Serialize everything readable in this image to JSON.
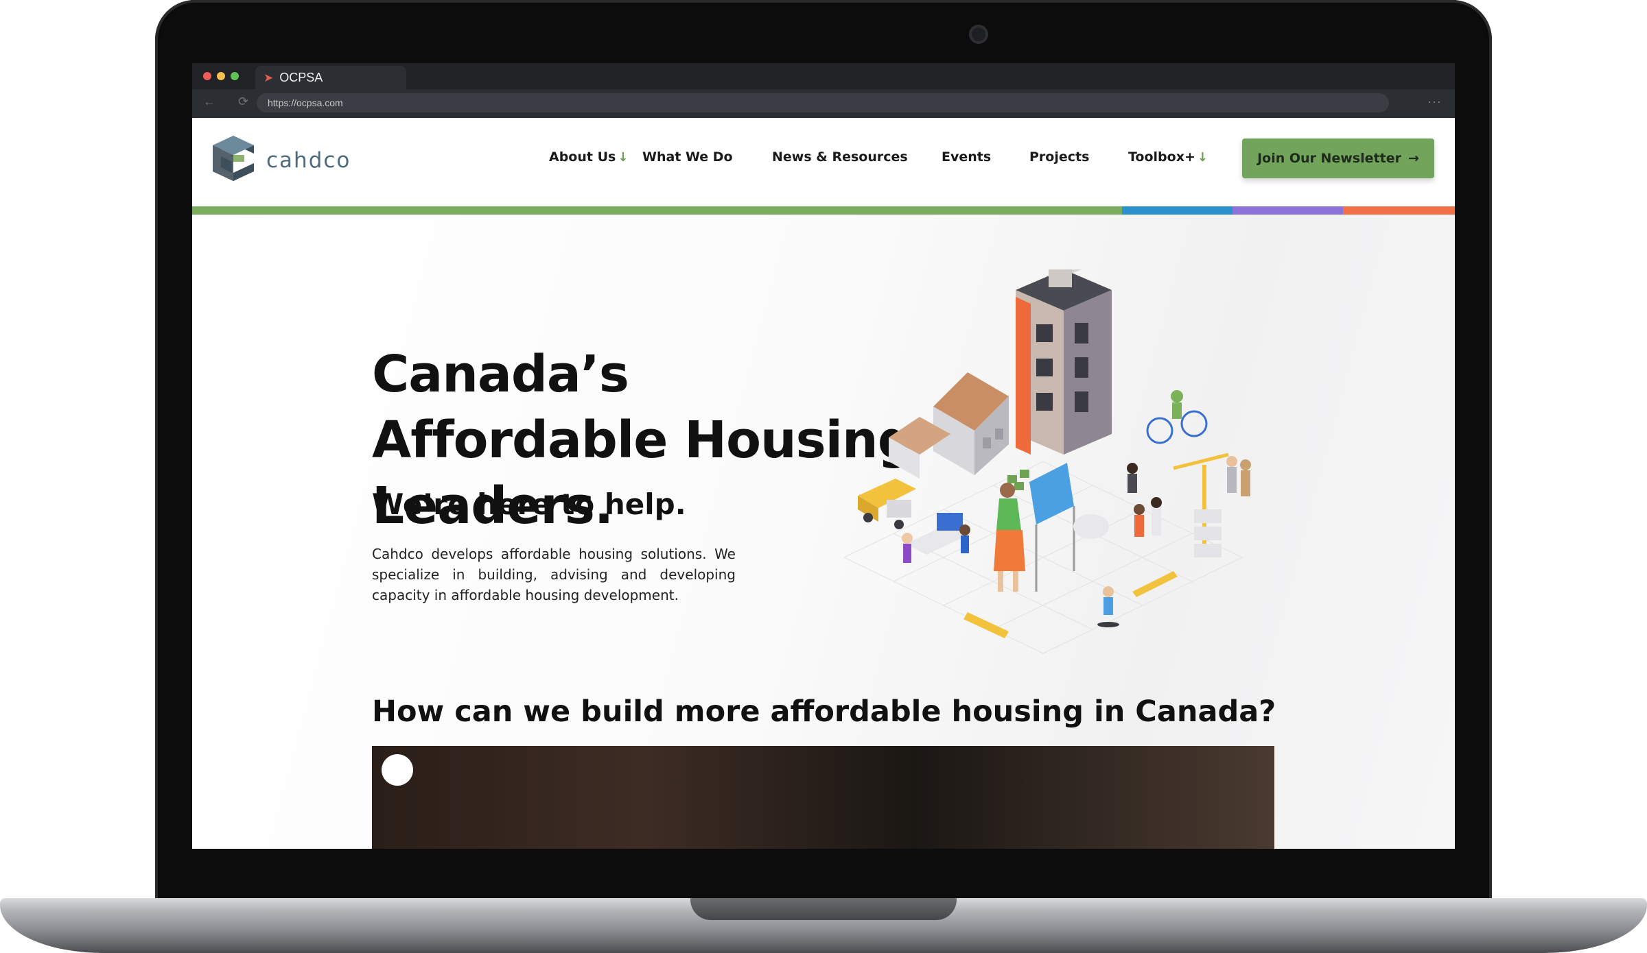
{
  "browser": {
    "tab_title": "OCPSA",
    "url": "https://ocpsa.com",
    "nav_arrows": "←  ⟳",
    "more": "···"
  },
  "site": {
    "brand": "cahdco",
    "nav": [
      {
        "label": "About Us",
        "has_dropdown": true
      },
      {
        "label": "What We Do",
        "has_dropdown": false
      },
      {
        "label": "News & Resources",
        "has_dropdown": false
      },
      {
        "label": "Events",
        "has_dropdown": false
      },
      {
        "label": "Projects",
        "has_dropdown": false
      },
      {
        "label": "Toolbox+",
        "has_dropdown": true
      }
    ],
    "dropdown_arrow": "↓",
    "cta": {
      "label": "Join Our Newsletter",
      "arrow": "→"
    },
    "color_bar": [
      "#7bab5f",
      "#2a91cc",
      "#8a72d6",
      "#f07048"
    ]
  },
  "hero": {
    "title": "Canada’s Affordable Housing Leaders.",
    "subtitle": "We’re here to help.",
    "body": "Cahdco develops affordable housing solutions. We specialize in building, advising and developing capacity in affordable housing development."
  },
  "section": {
    "heading": "How can we build more affordable housing in Canada?"
  },
  "colors": {
    "accent_green": "#72a55b",
    "brand_blue": "#4d6b7d",
    "text_dark": "#111111"
  }
}
